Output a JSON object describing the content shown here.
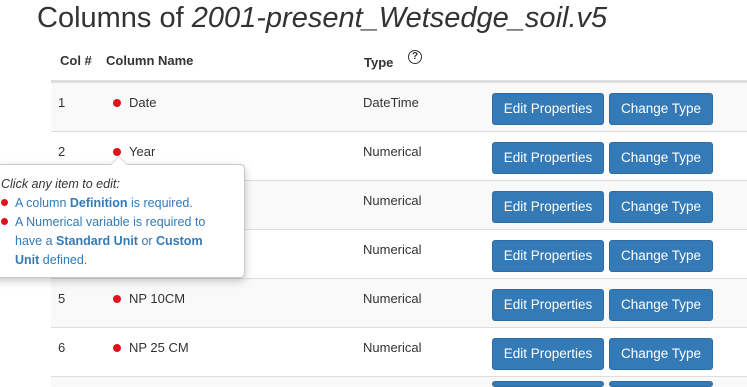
{
  "page": {
    "title_prefix": "Columns of ",
    "title_filename": "2001-present_Wetsedge_soil.v5"
  },
  "table": {
    "headers": {
      "col": "Col #",
      "name": "Column Name",
      "type": "Type",
      "help_icon": "question-circle-icon"
    },
    "rows": [
      {
        "num": "1",
        "name": "Date",
        "type": "DateTime"
      },
      {
        "num": "2",
        "name": "Year",
        "type": "Numerical"
      },
      {
        "num": "",
        "name": "",
        "type": "Numerical"
      },
      {
        "num": "",
        "name": "",
        "type": "Numerical"
      },
      {
        "num": "5",
        "name": "NP 10CM",
        "type": "Numerical"
      },
      {
        "num": "6",
        "name": "NP 25 CM",
        "type": "Numerical"
      }
    ],
    "edit_label": "Edit Properties",
    "change_label": "Change Type"
  },
  "popover": {
    "intro": "Click any item to edit:",
    "item1": {
      "pre": "A column ",
      "bold": "Definition",
      "post": " is required."
    },
    "item2": {
      "line1": "A Numerical variable is required to",
      "line2_pre": "have a ",
      "line2_bold1": "Standard Unit",
      "line2_mid": " or ",
      "line2_bold2": "Custom",
      "line3_bold": "Unit",
      "line3_post": " defined."
    }
  },
  "colors": {
    "primary": "#337ab7",
    "status_dot": "#e0121b",
    "row_stripe": "#f9f9f9"
  }
}
